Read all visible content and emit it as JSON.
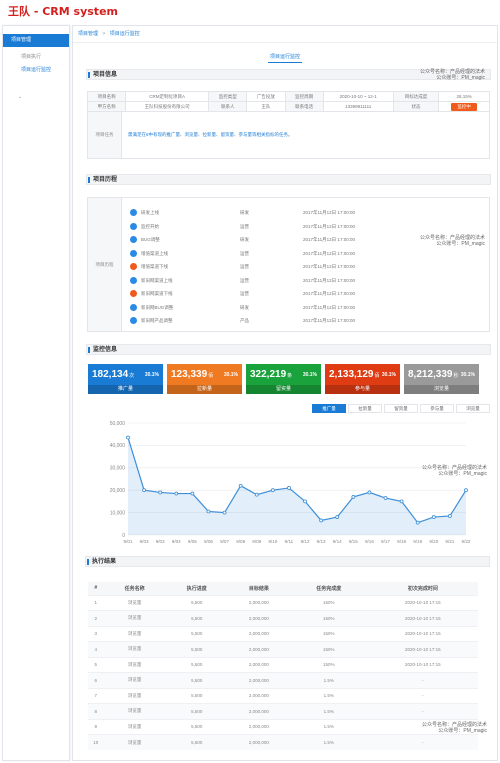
{
  "brand": "王队 - CRM system",
  "sidebar": {
    "items": [
      {
        "label": "项目管理",
        "state": "active"
      },
      {
        "label": "项目执行",
        "state": "sub"
      },
      {
        "label": "项目运行监控",
        "state": "current"
      }
    ]
  },
  "breadcrumb": {
    "parent": "项目管理",
    "separator": ">",
    "current": "项目运行监控"
  },
  "tab": "项目运行监控",
  "watermark": {
    "line1": "公众号名称：产品经理的法术",
    "line2": "公众账号：PM_magic"
  },
  "sections": {
    "info": "项目信息",
    "history": "项目历程",
    "monitor": "监控信息",
    "result": "执行结果"
  },
  "info": {
    "rows": [
      [
        "项目名称",
        "CRM定制化项目A",
        "监控类型",
        "广告投放",
        "监控周期",
        "2020-10-10 ~ 12-1",
        "目标达成度",
        "28.15%"
      ],
      [
        "甲方名称",
        "王队科技股份有限公司",
        "联系人",
        "王队",
        "联系电话",
        "13399911111",
        "状态",
        "监控中"
      ]
    ],
    "task_label": "项目任务",
    "task_text": "需满足在6中有现的推广量、浏览量、拉新量、留资量、参与量等相关指标的任务。"
  },
  "history": {
    "label": "项目历程",
    "rows": [
      {
        "name": "研发上线",
        "team": "研发",
        "time": "2017年11月12日 17:00:00",
        "color": "#2b8ae6"
      },
      {
        "name": "监控开始",
        "team": "运营",
        "time": "2017年11月12日 17:00:00",
        "color": "#2b8ae6"
      },
      {
        "name": "BUG调整",
        "team": "研发",
        "time": "2017年11月12日 17:00:00",
        "color": "#2b8ae6"
      },
      {
        "name": "增值渠道上线",
        "team": "运营",
        "time": "2017年11月12日 17:00:00",
        "color": "#2b8ae6"
      },
      {
        "name": "增值渠道下线",
        "team": "运营",
        "time": "2017年11月12日 17:00:00",
        "color": "#f05a1a"
      },
      {
        "name": "新旧网渠道上线",
        "team": "运营",
        "time": "2017年11月12日 17:00:00",
        "color": "#2b8ae6"
      },
      {
        "name": "新旧网渠道下线",
        "team": "运营",
        "time": "2017年11月12日 17:00:00",
        "color": "#f05a1a"
      },
      {
        "name": "新旧网BUG调整",
        "team": "研发",
        "time": "2017年11月12日 17:00:00",
        "color": "#2b8ae6"
      },
      {
        "name": "新旧网产品调整",
        "team": "产品",
        "time": "2017年11月12日 17:00:00",
        "color": "#2b8ae6"
      }
    ]
  },
  "cards": [
    {
      "value": "182,134",
      "unit": "次",
      "pct": "30.1%",
      "label": "推广量",
      "color": "#1a7bd5"
    },
    {
      "value": "123,339",
      "unit": "佰",
      "pct": "30.1%",
      "label": "拉新量",
      "color": "#f07a22"
    },
    {
      "value": "322,219",
      "unit": "条",
      "pct": "30.1%",
      "label": "留资量",
      "color": "#1aa33c"
    },
    {
      "value": "2,133,129",
      "unit": "佰",
      "pct": "30.1%",
      "label": "参与量",
      "color": "#e03c14"
    },
    {
      "value": "8,212,339",
      "unit": "秒",
      "pct": "30.1%",
      "label": "浏览量",
      "color": "#9a9a9a"
    }
  ],
  "chart_tabs": [
    "推广量",
    "拉新量",
    "留资量",
    "参与量",
    "浏览量"
  ],
  "chart_data": {
    "type": "area",
    "categories": [
      "9/01",
      "9/03",
      "9/02",
      "9/04",
      "9/05",
      "9/06",
      "9/07",
      "9/08",
      "9/09",
      "9/10",
      "9/11",
      "9/12",
      "9/13",
      "9/14",
      "9/15",
      "9/16",
      "9/17",
      "9/18",
      "9/19",
      "9/20",
      "9/21",
      "9/22"
    ],
    "values": [
      43500,
      20000,
      19000,
      18500,
      18500,
      10500,
      10000,
      22000,
      18000,
      20000,
      21000,
      15000,
      6500,
      8000,
      17000,
      19000,
      16500,
      15000,
      5500,
      8000,
      8500,
      20000
    ],
    "ylim": [
      0,
      50000
    ],
    "yticks": [
      "0",
      "10,000",
      "20,000",
      "30,000",
      "40,000",
      "50,000"
    ],
    "color": "#3d8fd8",
    "grid": true
  },
  "exec": {
    "headers": [
      "#",
      "任务名称",
      "执行进度",
      "目标结果",
      "任务完成度",
      "初次完成时间"
    ],
    "rows": [
      [
        "1",
        "浏览量",
        "5,500",
        "2,000,000",
        "150%",
        "2020-10-10 17:15"
      ],
      [
        "2",
        "浏览量",
        "5,500",
        "2,000,000",
        "150%",
        "2020-10-10 17:15"
      ],
      [
        "3",
        "浏览量",
        "5,500",
        "2,000,000",
        "150%",
        "2020-10-10 17:15"
      ],
      [
        "4",
        "浏览量",
        "5,500",
        "2,000,000",
        "150%",
        "2020-10-10 17:15"
      ],
      [
        "5",
        "浏览量",
        "5,500",
        "2,000,000",
        "150%",
        "2020-10-10 17:15"
      ],
      [
        "6",
        "浏览量",
        "5,500",
        "2,000,000",
        "1.5%",
        "-"
      ],
      [
        "7",
        "浏览量",
        "5,500",
        "2,000,000",
        "1.5%",
        "-"
      ],
      [
        "8",
        "浏览量",
        "5,500",
        "2,000,000",
        "1.5%",
        "-"
      ],
      [
        "9",
        "浏览量",
        "5,500",
        "2,000,000",
        "1.5%",
        "-"
      ],
      [
        "10",
        "浏览量",
        "5,500",
        "2,000,000",
        "1.5%",
        "-"
      ]
    ]
  }
}
